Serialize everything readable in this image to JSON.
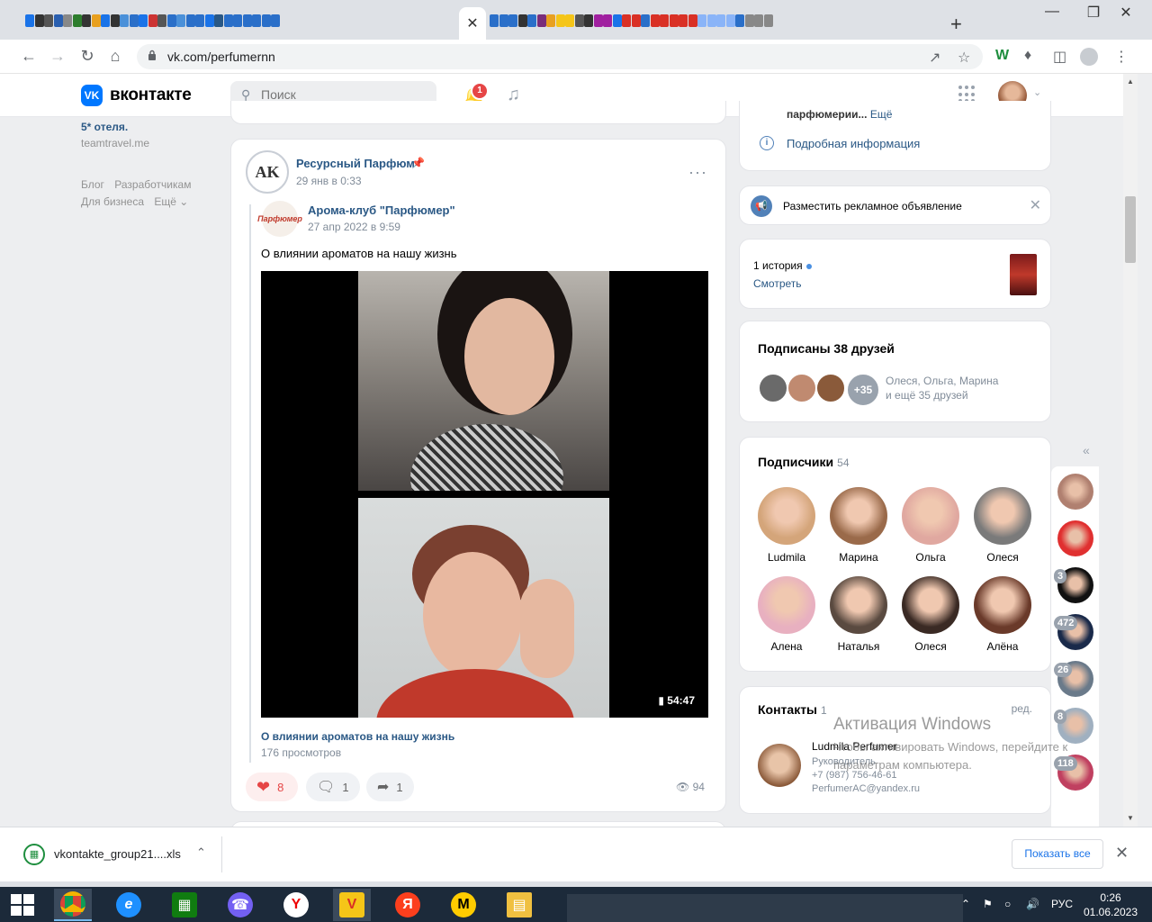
{
  "browser": {
    "close_tab_glyph": "✕",
    "new_tab_glyph": "+",
    "url": "vk.com/perfumernn",
    "favicon_colors": [
      "#1a73e8",
      "#333333",
      "#555555",
      "#2a5fb0",
      "#888888",
      "#2d7d2d",
      "#333333",
      "#e8a020",
      "#1a73e8",
      "#333333",
      "#4a90d9",
      "#2a6fc9",
      "#1a73e8",
      "#cc3333",
      "#555555",
      "#2a6fc9",
      "#4a90d9",
      "#2a6fc9",
      "#2a6fc9",
      "#1a73e8",
      "#2a5885",
      "#2a6fc9",
      "#2a6fc9",
      "#2a6fc9",
      "#2a6fc9",
      "#2a6fc9",
      "#2a6fc9"
    ],
    "favicon_colors_right": [
      "#2a6fc9",
      "#2a6fc9",
      "#2a6fc9",
      "#333333",
      "#2a6fc9",
      "#7a2d7a",
      "#e8a020",
      "#f5c518",
      "#f5c518",
      "#555555",
      "#333333",
      "#a020a0",
      "#a020a0",
      "#1a73e8",
      "#d93025",
      "#d93025",
      "#2a6fc9",
      "#d93025",
      "#d93025",
      "#d93025",
      "#d93025",
      "#d93025",
      "#8ab4f8",
      "#8ab4f8",
      "#8ab4f8",
      "#8ab4f8",
      "#2a6fc9",
      "#888888",
      "#888888",
      "#888888"
    ]
  },
  "header": {
    "logo_mark": "VK",
    "logo_text": "вконтакте",
    "search_placeholder": "Поиск",
    "notifications_count": "1"
  },
  "left": {
    "hotel": "5* отеля.",
    "site": "teamtravel.me",
    "links": [
      "Блог",
      "Разработчикам",
      "Для бизнеса",
      "Ещё ⌄"
    ]
  },
  "post": {
    "author": "Ресурсный Парфюм",
    "avatar_text": "AK",
    "date": "29 янв в 0:33",
    "more": "···",
    "repost_author": "Арома-клуб \"Парфюмер\"",
    "repost_avatar_text": "Парфюмер",
    "repost_date": "27 апр 2022 в 9:59",
    "text": "О влиянии ароматов на нашу жизнь",
    "video_duration": "54:47",
    "video_title": "О влиянии ароматов на нашу жизнь",
    "video_views": "176 просмотров",
    "likes": "8",
    "comments": "1",
    "shares": "1",
    "views": "94"
  },
  "right": {
    "cut_text": "парфюмерии...",
    "cut_more": "Ещё",
    "info_link": "Подробная информация",
    "ad_text": "Разместить рекламное объявление",
    "story_count": "1 история",
    "story_watch": "Смотреть",
    "friends_title": "Подписаны 38 друзей",
    "friends_more": "+35",
    "friends_names_1": "Олеся, Ольга, Марина",
    "friends_names_2": "и ещё 35 друзей",
    "subs_title": "Подписчики",
    "subs_count": "54",
    "subscribers": [
      {
        "name": "Ludmila",
        "color": "#d4a57a"
      },
      {
        "name": "Марина",
        "color": "#9a6a4a"
      },
      {
        "name": "Ольга",
        "color": "#e0a8a0"
      },
      {
        "name": "Олеся",
        "color": "#7a7a7a"
      },
      {
        "name": "Алена",
        "color": "#e8b0c0"
      },
      {
        "name": "Наталья",
        "color": "#5a4a40"
      },
      {
        "name": "Олеся",
        "color": "#3a2a24"
      },
      {
        "name": "Алёна",
        "color": "#6a3a2a"
      }
    ],
    "contacts_title": "Контакты",
    "contacts_count": "1",
    "contacts_edit": "ред.",
    "contact_name": "Ludmila Perfumer",
    "contact_role": "Руководитель",
    "contact_phone": "+7 (987) 756-46-61",
    "contact_email": "PerfumerAC@yandex.ru"
  },
  "chats": [
    {
      "badge": "",
      "color": "#b08070"
    },
    {
      "badge": "",
      "color": "#e03030"
    },
    {
      "badge": "3",
      "color": "#111111"
    },
    {
      "badge": "472",
      "color": "#1a2a4a"
    },
    {
      "badge": "26",
      "color": "#6a7a8a"
    },
    {
      "badge": "8",
      "color": "#a0b0c0"
    },
    {
      "badge": "118",
      "color": "#c04060"
    }
  ],
  "watermark": {
    "line1": "Активация Windows",
    "line2": "Чтобы активировать Windows, перейдите к параметрам компьютера."
  },
  "downloads": {
    "file": "vkontakte_group21....xls",
    "show_all": "Показать все"
  },
  "taskbar": {
    "lang": "РУС",
    "time": "0:26",
    "date": "01.06.2023"
  }
}
